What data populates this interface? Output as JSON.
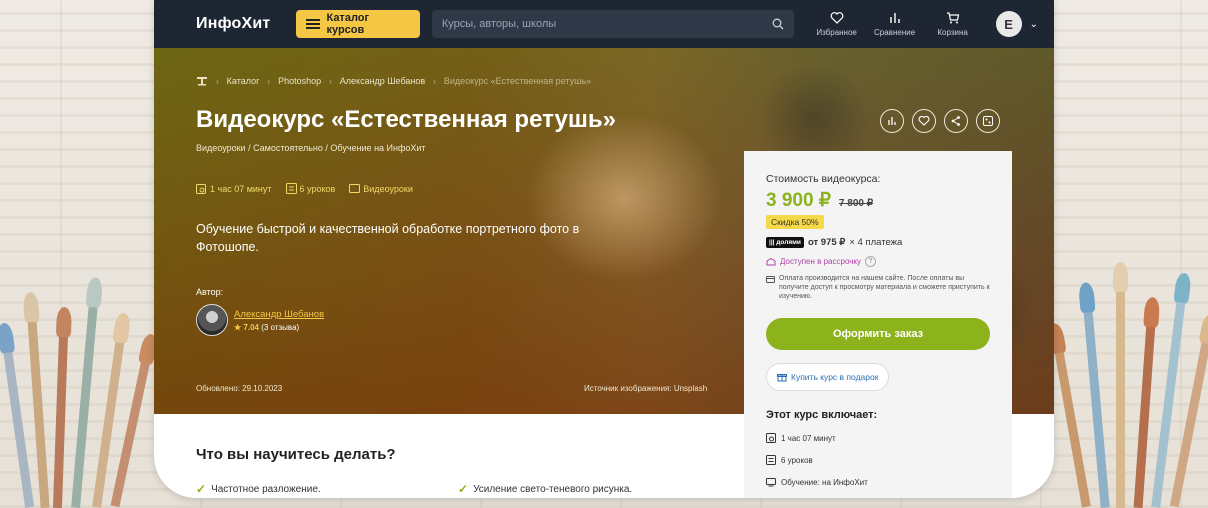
{
  "header": {
    "logo": "ИнфоХит",
    "catalog_label": "Каталог курсов",
    "search_placeholder": "Курсы, авторы, школы",
    "nav": [
      {
        "icon": "heart-icon",
        "label": "Избранное"
      },
      {
        "icon": "compare-icon",
        "label": "Сравнение"
      },
      {
        "icon": "cart-icon",
        "label": "Корзина"
      }
    ],
    "user_initial": "E"
  },
  "breadcrumb": [
    "Каталог",
    "Photoshop",
    "Александр Шебанов",
    "Видеокурс «Естественная ретушь»"
  ],
  "course": {
    "title": "Видеокурс «Естественная ретушь»",
    "subtitle": "Видеоуроки / Самостоятельно / Обучение на ИнфоХит",
    "duration": "1 час 07 минут",
    "lessons": "6 уроков",
    "format": "Видеоуроки",
    "description": "Обучение быстрой и качественной обработке портретного фото в Фотошопе.",
    "author_label": "Автор:",
    "author_name": "Александр Шебанов",
    "author_rating": "7.04",
    "author_reviews": "(3 отзыва)",
    "updated": "Обновлено: 29.10.2023",
    "image_source": "Источник изображения: Unsplash"
  },
  "price_card": {
    "label": "Стоимость видеокурса:",
    "price": "3 900 ₽",
    "old_price": "7 800 ₽",
    "discount": "Скидка 50%",
    "dolyami_tag": "||| долями",
    "dolyami_text_bold": "от 975 ₽",
    "dolyami_text": "× 4 платежа",
    "installment": "Доступен в рассрочку",
    "installment_q": "?",
    "pay_info": "Оплата производится на нашем сайте. После оплаты вы получите доступ к просмотру материала и сможете приступить к изучению.",
    "order_button": "Оформить заказ",
    "gift_button": "Купить курс в подарок",
    "includes_title": "Этот курс включает:",
    "includes": [
      "1 час 07 минут",
      "6 уроков",
      "Обучение: на ИнфоХит"
    ]
  },
  "learn": {
    "title": "Что вы научитесь делать?",
    "items": [
      "Частотное разложение.",
      "Усиление свето-теневого рисунка."
    ]
  },
  "colors": {
    "accent_green": "#8cb21c",
    "yellow": "#f4c744",
    "header_bg": "#1f2633"
  }
}
